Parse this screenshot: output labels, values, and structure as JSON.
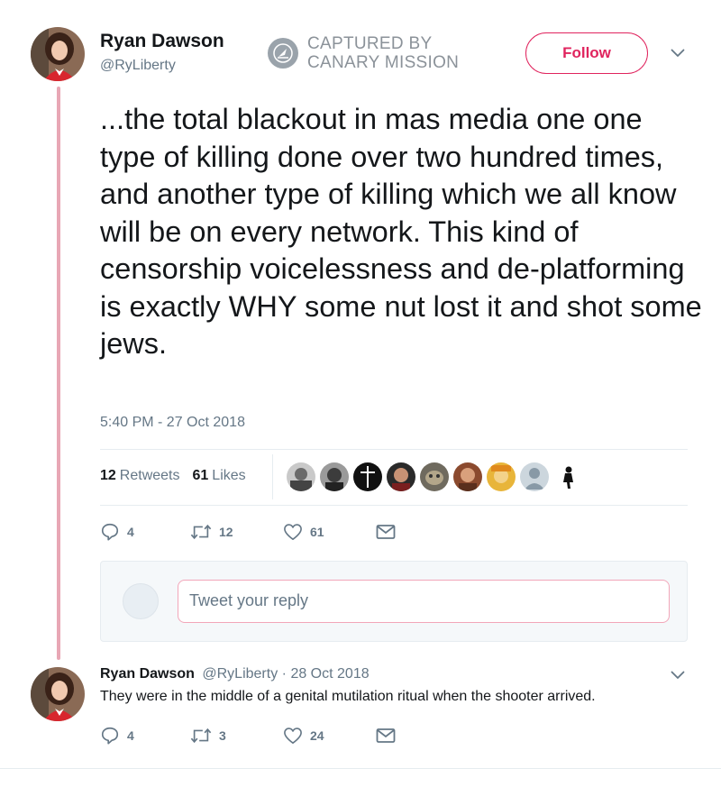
{
  "tweet": {
    "author_name": "Ryan Dawson",
    "author_handle": "@RyLiberty",
    "follow_label": "Follow",
    "text": "...the total blackout in mas media one one type of killing done over two hundred times, and another type of killing which we all know will be on every network. This kind of censorship voicelessness and de-platforming is exactly WHY some nut lost it and shot some jews.",
    "timestamp": "5:40 PM - 27 Oct 2018",
    "retweets_count": "12",
    "retweets_label": "Retweets",
    "likes_count": "61",
    "likes_label": "Likes",
    "actions": {
      "replies": "4",
      "retweets": "12",
      "likes": "61"
    }
  },
  "watermark": {
    "line1": "CAPTURED BY",
    "line2": "CANARY MISSION"
  },
  "reply_box": {
    "placeholder": "Tweet your reply"
  },
  "reply": {
    "author_name": "Ryan Dawson",
    "author_handle": "@RyLiberty",
    "separator": "·",
    "date": "28 Oct 2018",
    "text": "They were in the middle of a genital mutilation ritual when the shooter arrived.",
    "actions": {
      "replies": "4",
      "retweets": "3",
      "likes": "24"
    }
  },
  "colors": {
    "accent": "#e0245e",
    "thread_line": "#e8a7b5",
    "muted": "#657786"
  },
  "icons": [
    "reply-icon",
    "retweet-icon",
    "heart-icon",
    "envelope-icon",
    "chevron-down-icon",
    "canary-logo-icon"
  ]
}
